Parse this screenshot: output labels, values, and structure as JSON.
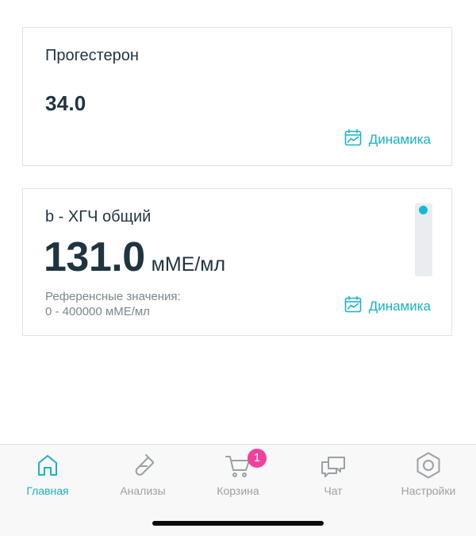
{
  "results": [
    {
      "title": "Прогестерон",
      "value": "34.0",
      "dynamics_label": "Динамика"
    },
    {
      "title": "b - ХГЧ общий",
      "value": "131.0",
      "unit": "мМЕ/мл",
      "reference_label": "Референсные значения:",
      "reference_range": "0 - 400000 мМЕ/мл",
      "dynamics_label": "Динамика",
      "scale_level": 0.0003
    }
  ],
  "tabbar": {
    "items": [
      {
        "label": "Главная",
        "icon": "home-icon",
        "active": true
      },
      {
        "label": "Анализы",
        "icon": "test-tube-icon",
        "active": false
      },
      {
        "label": "Корзина",
        "icon": "cart-icon",
        "active": false,
        "badge": "1"
      },
      {
        "label": "Чат",
        "icon": "chat-icon",
        "active": false
      },
      {
        "label": "Настройки",
        "icon": "settings-icon",
        "active": false
      }
    ]
  },
  "colors": {
    "accent": "#17b3c7",
    "badge": "#f0419c",
    "text_primary": "#1f3440",
    "text_secondary": "#7c868c",
    "inactive": "#9aa1a6"
  }
}
